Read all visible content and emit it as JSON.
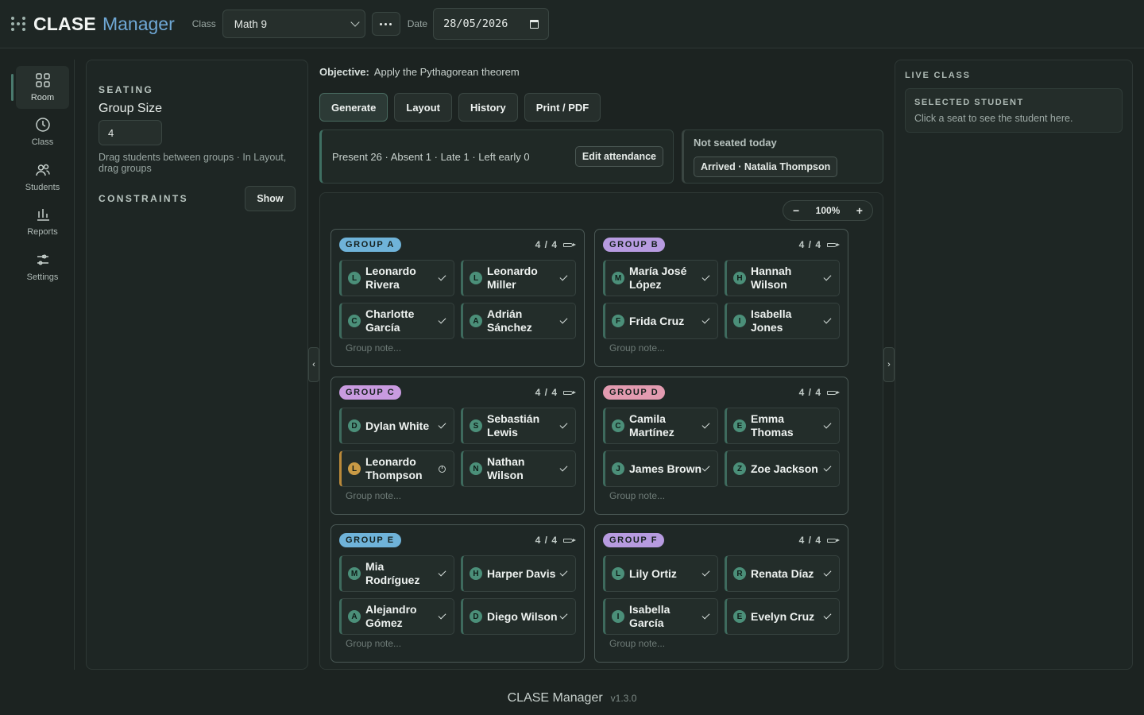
{
  "header": {
    "brand_bold": "CLASE",
    "brand_light": "Manager",
    "class_label": "Class",
    "class_value": "Math 9",
    "date_label": "Date",
    "date_value": "28/05/2026"
  },
  "nav": {
    "items": [
      {
        "label": "Room",
        "icon": "grid-icon"
      },
      {
        "label": "Class",
        "icon": "clock-icon"
      },
      {
        "label": "Students",
        "icon": "users-icon"
      },
      {
        "label": "Reports",
        "icon": "bar-chart-icon"
      },
      {
        "label": "Settings",
        "icon": "sliders-icon"
      }
    ]
  },
  "seating": {
    "title": "SEATING",
    "group_size_label": "Group Size",
    "group_size_value": "4",
    "hint": "Drag students between groups · In Layout, drag groups",
    "constraints_label": "CONSTRAINTS",
    "show_label": "Show"
  },
  "objective": {
    "label": "Objective:",
    "text": "Apply the Pythagorean theorem"
  },
  "toolbar": {
    "generate": "Generate",
    "layout": "Layout",
    "history": "History",
    "print": "Print / PDF"
  },
  "attendance": {
    "summary": "Present 26 · Absent 1 · Late 1 · Left early 0",
    "edit_label": "Edit attendance"
  },
  "not_seated": {
    "title": "Not seated today",
    "chip": "Arrived · Natalia Thompson"
  },
  "zoom": {
    "minus": "−",
    "value": "100%",
    "plus": "+"
  },
  "groups": [
    {
      "name": "GROUP A",
      "count": "4 / 4",
      "note": "Group note...",
      "students": [
        {
          "initial": "L",
          "name": "Leonardo Rivera",
          "status": "check"
        },
        {
          "initial": "L",
          "name": "Leonardo Miller",
          "status": "check"
        },
        {
          "initial": "C",
          "name": "Charlotte García",
          "status": "check"
        },
        {
          "initial": "A",
          "name": "Adrián Sánchez",
          "status": "check"
        }
      ]
    },
    {
      "name": "GROUP B",
      "count": "4 / 4",
      "note": "Group note...",
      "students": [
        {
          "initial": "M",
          "name": "María José López",
          "status": "check"
        },
        {
          "initial": "H",
          "name": "Hannah Wilson",
          "status": "check"
        },
        {
          "initial": "F",
          "name": "Frida Cruz",
          "status": "check"
        },
        {
          "initial": "I",
          "name": "Isabella Jones",
          "status": "check"
        }
      ]
    },
    {
      "name": "GROUP C",
      "count": "4 / 4",
      "note": "Group note...",
      "students": [
        {
          "initial": "D",
          "name": "Dylan White",
          "status": "check"
        },
        {
          "initial": "S",
          "name": "Sebastián Lewis",
          "status": "check"
        },
        {
          "initial": "L",
          "name": "Leonardo Thompson",
          "status": "late"
        },
        {
          "initial": "N",
          "name": "Nathan Wilson",
          "status": "check"
        }
      ]
    },
    {
      "name": "GROUP D",
      "count": "4 / 4",
      "note": "Group note...",
      "students": [
        {
          "initial": "C",
          "name": "Camila Martínez",
          "status": "check"
        },
        {
          "initial": "E",
          "name": "Emma Thomas",
          "status": "check"
        },
        {
          "initial": "J",
          "name": "James Brown",
          "status": "check"
        },
        {
          "initial": "Z",
          "name": "Zoe Jackson",
          "status": "check"
        }
      ]
    },
    {
      "name": "GROUP E",
      "count": "4 / 4",
      "note": "Group note...",
      "students": [
        {
          "initial": "M",
          "name": "Mia Rodríguez",
          "status": "check"
        },
        {
          "initial": "H",
          "name": "Harper Davis",
          "status": "check"
        },
        {
          "initial": "A",
          "name": "Alejandro Gómez",
          "status": "check"
        },
        {
          "initial": "D",
          "name": "Diego Wilson",
          "status": "check"
        }
      ]
    },
    {
      "name": "GROUP F",
      "count": "4 / 4",
      "note": "Group note...",
      "students": [
        {
          "initial": "L",
          "name": "Lily Ortiz",
          "status": "check"
        },
        {
          "initial": "R",
          "name": "Renata Díaz",
          "status": "check"
        },
        {
          "initial": "I",
          "name": "Isabella García",
          "status": "check"
        },
        {
          "initial": "E",
          "name": "Evelyn Cruz",
          "status": "check"
        }
      ]
    }
  ],
  "live": {
    "title": "LIVE CLASS",
    "selected_title": "SELECTED STUDENT",
    "selected_hint": "Click a seat to see the student here."
  },
  "footer": {
    "app": "CLASE Manager",
    "version": "v1.3.0"
  },
  "colors": {
    "group_a": "#6fb3d9",
    "group_b": "#b79be0",
    "group_c": "#c99be0",
    "group_d": "#e29bb0",
    "group_e": "#6fb3d9",
    "group_f": "#b79be0",
    "present": "#3e6a5d",
    "late": "#b9893a"
  }
}
